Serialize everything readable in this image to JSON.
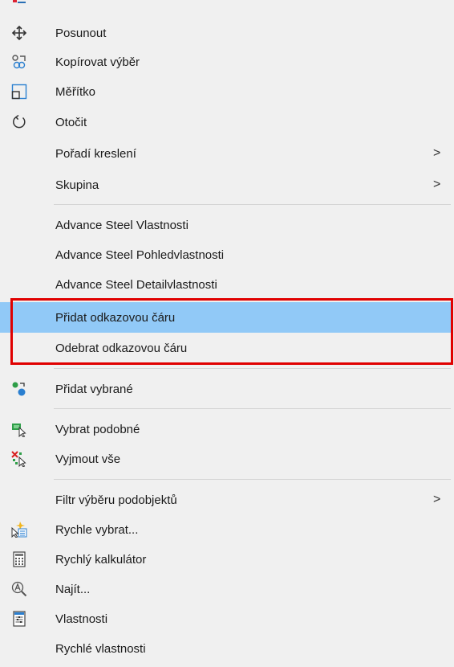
{
  "menu": {
    "items": [
      {
        "id": "posunout",
        "label": "Posunout",
        "icon": "move-icon"
      },
      {
        "id": "kopirovat",
        "label": "Kopírovat výběr",
        "icon": "copy-selection-icon"
      },
      {
        "id": "meritko",
        "label": "Měřítko",
        "icon": "scale-icon"
      },
      {
        "id": "otocit",
        "label": "Otočit",
        "icon": "rotate-icon"
      },
      {
        "id": "poradi",
        "label": "Pořadí kreslení",
        "submenu": true,
        "arrow": ">"
      },
      {
        "id": "skupina",
        "label": "Skupina",
        "submenu": true,
        "arrow": ">"
      },
      {
        "id": "as-vlastnosti",
        "label": "Advance Steel Vlastnosti"
      },
      {
        "id": "as-pohled",
        "label": "Advance Steel Pohledvlastnosti"
      },
      {
        "id": "as-detail",
        "label": "Advance Steel Detailvlastnosti"
      },
      {
        "id": "pridat-odkaz",
        "label": "Přidat odkazovou čáru",
        "highlighted": true
      },
      {
        "id": "odebrat-odkaz",
        "label": "Odebrat odkazovou čáru"
      },
      {
        "id": "pridat-vybrane",
        "label": "Přidat vybrané",
        "icon": "add-selected-icon"
      },
      {
        "id": "vybrat-podobne",
        "label": "Vybrat podobné",
        "icon": "select-similar-icon"
      },
      {
        "id": "vyjmout-vse",
        "label": "Vyjmout vše",
        "icon": "deselect-all-icon"
      },
      {
        "id": "filtr",
        "label": "Filtr výběru podobjektů",
        "submenu": true,
        "arrow": ">"
      },
      {
        "id": "rychle-vybrat",
        "label": "Rychle vybrat...",
        "icon": "quick-select-icon"
      },
      {
        "id": "kalkulator",
        "label": "Rychlý kalkulátor",
        "icon": "calculator-icon"
      },
      {
        "id": "najit",
        "label": "Najít...",
        "icon": "find-icon"
      },
      {
        "id": "vlastnosti",
        "label": "Vlastnosti",
        "icon": "properties-icon"
      },
      {
        "id": "rychle-vlastnosti",
        "label": "Rychlé vlastnosti"
      }
    ]
  },
  "colors": {
    "highlight": "#91c9f7",
    "annotation_box": "#e00000",
    "menu_background": "#f0f0f0"
  }
}
